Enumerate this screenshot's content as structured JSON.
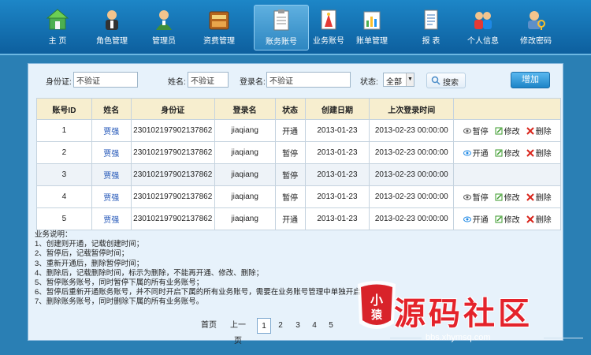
{
  "nav": {
    "items": [
      {
        "label": "主  页",
        "icon": "home-icon"
      },
      {
        "label": "角色管理",
        "icon": "role-icon"
      },
      {
        "label": "管理员",
        "icon": "admin-icon"
      },
      {
        "label": "资费管理",
        "icon": "fee-icon"
      },
      {
        "label": "账务账号",
        "icon": "account-icon"
      },
      {
        "label": "业务账号",
        "icon": "service-icon"
      },
      {
        "label": "账单管理",
        "icon": "bill-icon"
      },
      {
        "label": "报  表",
        "icon": "report-icon"
      },
      {
        "label": "个人信息",
        "icon": "user-info-icon"
      },
      {
        "label": "修改密码",
        "icon": "password-icon"
      }
    ],
    "active_index": 4
  },
  "search": {
    "idcard_label": "身份证:",
    "idcard_value": "不验证",
    "name_label": "姓名:",
    "name_value": "不验证",
    "login_label": "登录名:",
    "login_value": "不验证",
    "status_label": "状态:",
    "status_value": "全部",
    "search_button": "搜索",
    "add_button": "增加"
  },
  "table": {
    "headers": [
      "账号ID",
      "姓名",
      "身份证",
      "登录名",
      "状态",
      "创建日期",
      "上次登录时间",
      ""
    ],
    "rows": [
      {
        "id": "1",
        "name": "贾强",
        "idcard": "230102197902137862",
        "login": "jiaqiang",
        "status": "开通",
        "created": "2013-01-23",
        "last_login": "2013-02-23 00:00:00",
        "ops": [
          "暂停",
          "修改",
          "删除"
        ]
      },
      {
        "id": "2",
        "name": "贾强",
        "idcard": "230102197902137862",
        "login": "jiaqiang",
        "status": "暂停",
        "created": "2013-01-23",
        "last_login": "2013-02-23 00:00:00",
        "ops": [
          "开通",
          "修改",
          "删除"
        ]
      },
      {
        "id": "3",
        "name": "贾强",
        "idcard": "230102197902137862",
        "login": "jiaqiang",
        "status": "暂停",
        "created": "2013-01-23",
        "last_login": "2013-02-23 00:00:00",
        "ops": []
      },
      {
        "id": "4",
        "name": "贾强",
        "idcard": "230102197902137862",
        "login": "jiaqiang",
        "status": "暂停",
        "created": "2013-01-23",
        "last_login": "2013-02-23 00:00:00",
        "ops": [
          "暂停",
          "修改",
          "删除"
        ]
      },
      {
        "id": "5",
        "name": "贾强",
        "idcard": "230102197902137862",
        "login": "jiaqiang",
        "status": "开通",
        "created": "2013-01-23",
        "last_login": "2013-02-23 00:00:00",
        "ops": [
          "开通",
          "修改",
          "删除"
        ]
      }
    ]
  },
  "notes": {
    "title": "业务说明：",
    "lines": [
      "1、创建则开通，记载创建时间；",
      "2、暂停后，记载暂停时间；",
      "3、重新开通后，删除暂停时间；",
      "4、删除后，记载删除时间，标示为删除，不能再开通、修改、删除；",
      "5、暂停账务账号，同时暂停下属的所有业务账号；",
      "6、暂停后重新开通账务账号，并不同时开启下属的所有业务账号，需要在业务账号管理中单独开启；",
      "7、删除账务账号，同时删除下属的所有业务账号。"
    ]
  },
  "pager": {
    "first": "首页",
    "prev": "上一页",
    "pages": [
      "1",
      "2",
      "3",
      "4",
      "5"
    ],
    "current": "1"
  },
  "watermark": {
    "badge": "小猿",
    "title": "源码社区",
    "url": "bbs.xhymsq.com"
  },
  "colors": {
    "nav_bg": "#0d5f9e",
    "header_bg": "#f7eecf",
    "name_link": "#2256b8",
    "delete_red": "#d9261c",
    "edit_green": "#3a9a2a",
    "watermark_red": "#e4232b"
  }
}
